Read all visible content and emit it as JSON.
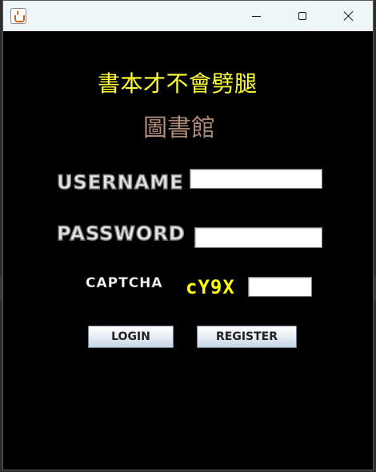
{
  "window": {
    "title": "",
    "controls": {
      "minimize_icon": "minimize-icon",
      "maximize_icon": "maximize-icon",
      "close_icon": "close-icon"
    },
    "app_icon": "java-cup-icon"
  },
  "form": {
    "title": "書本才不會劈腿",
    "subtitle": "圖書館",
    "username_label": "USERNAME",
    "username_value": "",
    "password_label": "PASSWORD",
    "password_value": "",
    "captcha_label": "CAPTCHA",
    "captcha_code": "cY9X",
    "captcha_value": ""
  },
  "buttons": {
    "login": "LOGIN",
    "register": "REGISTER"
  },
  "colors": {
    "background": "#000000",
    "title": "#ffff33",
    "subtitle": "#b08a78",
    "captcha_code": "#ffff00",
    "titlebar": "#eef6f9"
  }
}
